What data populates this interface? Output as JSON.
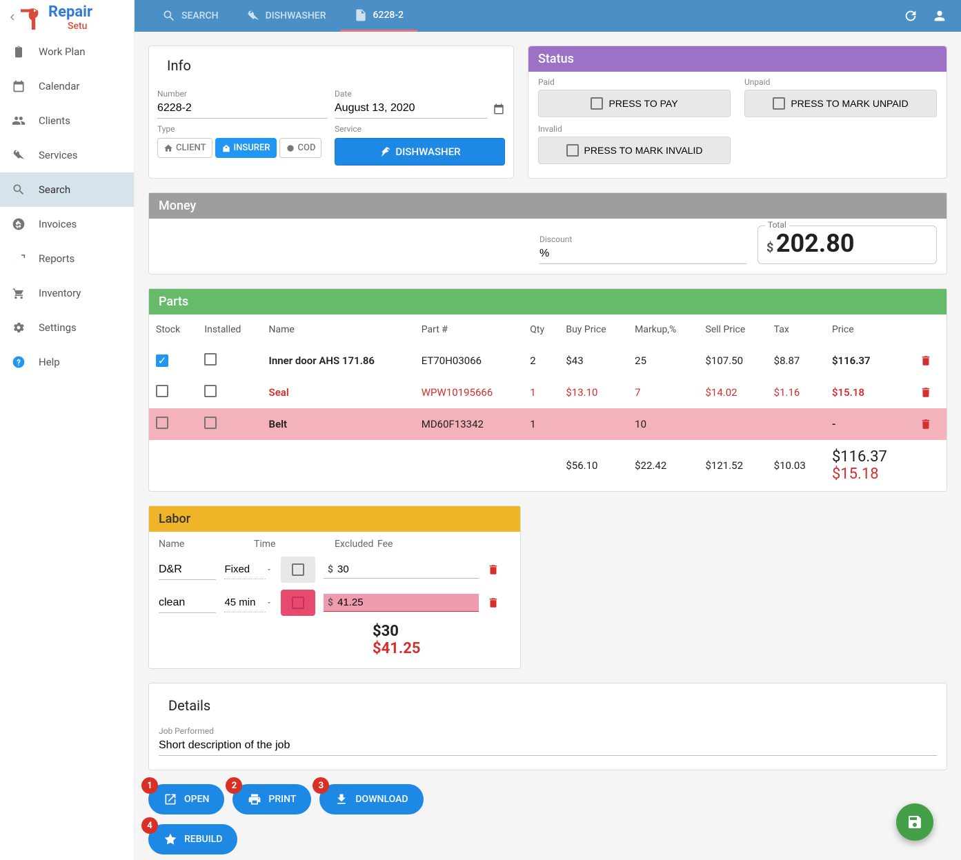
{
  "logo": {
    "text1": "Repair",
    "text2": "Setu",
    "color1": "#2f7bd8",
    "color2": "#d94b3a"
  },
  "topbar": {
    "tabs": [
      {
        "label": "SEARCH",
        "icon": "search"
      },
      {
        "label": "DISHWASHER",
        "icon": "wrench"
      },
      {
        "label": "6228-2",
        "icon": "file"
      }
    ],
    "active": 2
  },
  "sidebar": {
    "items": [
      {
        "label": "Work Plan",
        "icon": "clipboard"
      },
      {
        "label": "Calendar",
        "icon": "calendar"
      },
      {
        "label": "Clients",
        "icon": "people"
      },
      {
        "label": "Services",
        "icon": "wrench"
      },
      {
        "label": "Search",
        "icon": "search"
      },
      {
        "label": "Invoices",
        "icon": "dollar"
      },
      {
        "label": "Reports",
        "icon": "trend"
      },
      {
        "label": "Inventory",
        "icon": "cart"
      },
      {
        "label": "Settings",
        "icon": "gear"
      },
      {
        "label": "Help",
        "icon": "help"
      }
    ],
    "active": 4
  },
  "info": {
    "title": "Info",
    "number_label": "Number",
    "number": "6228-2",
    "date_label": "Date",
    "date": "August 13, 2020",
    "type_label": "Type",
    "types": [
      {
        "label": "CLIENT"
      },
      {
        "label": "INSURER"
      },
      {
        "label": "COD"
      }
    ],
    "type_active": 1,
    "service_label": "Service",
    "service": "DISHWASHER"
  },
  "status": {
    "title": "Status",
    "paid_label": "Paid",
    "paid_btn": "PRESS TO PAY",
    "unpaid_label": "Unpaid",
    "unpaid_btn": "PRESS TO MARK UNPAID",
    "invalid_label": "Invalid",
    "invalid_btn": "PRESS TO MARK INVALID"
  },
  "money": {
    "title": "Money",
    "discount_label": "Discount",
    "discount": "%",
    "total_label": "Total",
    "currency": "$",
    "total": "202.80"
  },
  "parts": {
    "title": "Parts",
    "headers": [
      "Stock",
      "Installed",
      "Name",
      "Part #",
      "Qty",
      "Buy Price",
      "Markup,%",
      "Sell Price",
      "Tax",
      "Price",
      ""
    ],
    "rows": [
      {
        "stock": true,
        "installed": false,
        "name": "Inner door AHS 171.86",
        "partno": "ET70H03066",
        "qty": "2",
        "buy": "$43",
        "markup": "25",
        "sell": "$107.50",
        "tax": "$8.87",
        "price": "$116.37",
        "style": "normal"
      },
      {
        "stock": false,
        "installed": false,
        "name": "Seal",
        "partno": "WPW10195666",
        "qty": "1",
        "buy": "$13.10",
        "markup": "7",
        "sell": "$14.02",
        "tax": "$1.16",
        "price": "$15.18",
        "style": "red"
      },
      {
        "stock": false,
        "installed": false,
        "name": "Belt",
        "partno": "MD60F13342",
        "qty": "1",
        "buy": "",
        "markup": "10",
        "sell": "",
        "tax": "",
        "price": "-",
        "style": "pink"
      }
    ],
    "totals": {
      "buy": "$56.10",
      "markup": "$22.42",
      "sell": "$121.52",
      "tax": "$10.03",
      "price1": "$116.37",
      "price2": "$15.18"
    }
  },
  "labor": {
    "title": "Labor",
    "headers": [
      "Name",
      "Time",
      "Excluded",
      "Fee"
    ],
    "rows": [
      {
        "name": "D&R",
        "time": "Fixed",
        "excluded": false,
        "fee": "30",
        "pink": false
      },
      {
        "name": "clean",
        "time": "45 min",
        "excluded": true,
        "fee": "41.25",
        "pink": true
      }
    ],
    "totals": {
      "t1": "$30",
      "t2": "$41.25"
    }
  },
  "details": {
    "title": "Details",
    "job_label": "Job Performed",
    "job": "Short description of the job"
  },
  "actions": [
    {
      "num": "1",
      "label": "OPEN",
      "icon": "open"
    },
    {
      "num": "2",
      "label": "PRINT",
      "icon": "print"
    },
    {
      "num": "3",
      "label": "DOWNLOAD",
      "icon": "download"
    },
    {
      "num": "4",
      "label": "REBUILD",
      "icon": "star"
    }
  ]
}
